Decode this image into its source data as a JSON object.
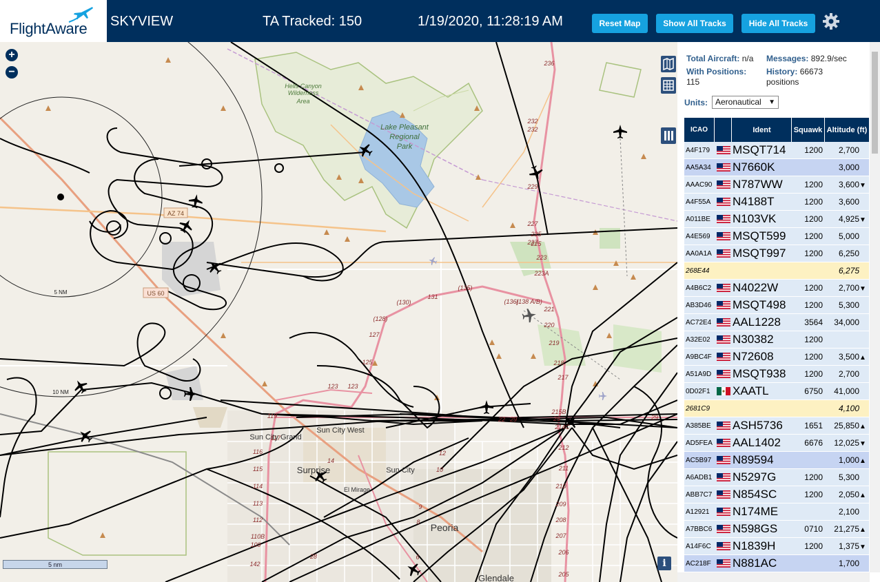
{
  "header": {
    "logo_text": "FlightAware",
    "app_title": "SKYVIEW",
    "tracked": "TA Tracked: 150",
    "datetime": "1/19/2020, 11:28:19 AM",
    "reset_label": "Reset Map",
    "show_label": "Show All Tracks",
    "hide_label": "Hide All Tracks"
  },
  "map": {
    "zoom_in": "+",
    "zoom_out": "−",
    "scale_label": "5 nm",
    "info_label": "i",
    "labels": {
      "hells_canyon": "Hells Canyon",
      "wilderness": "Wilderness",
      "area": "Area",
      "lake1": "Lake Pleasant",
      "lake2": "Regional",
      "lake3": "Park",
      "sun_city_grand": "Sun City Grand",
      "sun_city_west": "Sun City West",
      "surprise": "Surprise",
      "sun_city": "Sun City",
      "el_mirage": "El Mirage",
      "peoria": "Peoria",
      "glendale": "Glendale",
      "az74": "AZ 74",
      "us60": "US 60",
      "ring5": "5 NM",
      "ring10": "10 NM"
    },
    "road_numbers": [
      "236",
      "232",
      "232",
      "229",
      "227",
      "227",
      "225",
      "225",
      "223",
      "223A",
      "221",
      "220",
      "219",
      "218",
      "217",
      "215B",
      "214C",
      "212",
      "211",
      "210",
      "209",
      "208",
      "207",
      "206",
      "205",
      "(138 A/B)",
      "(136)",
      "(135)",
      "131",
      "(130)",
      "(128)",
      "127",
      "125",
      "123",
      "123",
      "119",
      "117",
      "116",
      "115",
      "114",
      "113",
      "112",
      "110B",
      "109",
      "142",
      "14",
      "12",
      "10",
      "9",
      "8",
      "6",
      "28",
      "29",
      "22",
      "25",
      "29"
    ]
  },
  "panel": {
    "total_label": "Total Aircraft:",
    "total_value": "n/a",
    "messages_label": "Messages:",
    "messages_value": "892.9/sec",
    "positions_label": "With Positions:",
    "positions_value": "115",
    "history_label": "History:",
    "history_value": "66673",
    "history_unit": "positions",
    "units_label": "Units:",
    "units_value": "Aeronautical"
  },
  "table": {
    "headers": {
      "icao": "ICAO",
      "flag": "",
      "ident": "Ident",
      "squawk": "Squawk",
      "altitude": "Altitude (ft)"
    },
    "rows": [
      {
        "icao": "A4F179",
        "flag": "us",
        "ident": "MSQT714",
        "squawk": "1200",
        "altitude": "2,700",
        "trend": "",
        "style": "blue"
      },
      {
        "icao": "AA5A34",
        "flag": "us",
        "ident": "N7660K",
        "squawk": "",
        "altitude": "3,000",
        "trend": "",
        "style": "selected"
      },
      {
        "icao": "AAAC90",
        "flag": "us",
        "ident": "N787WW",
        "squawk": "1200",
        "altitude": "3,600",
        "trend": "▼",
        "style": "blue"
      },
      {
        "icao": "A4F55A",
        "flag": "us",
        "ident": "N4188T",
        "squawk": "1200",
        "altitude": "3,600",
        "trend": "",
        "style": "blue"
      },
      {
        "icao": "A011BE",
        "flag": "us",
        "ident": "N103VK",
        "squawk": "1200",
        "altitude": "4,925",
        "trend": "▼",
        "style": "blue"
      },
      {
        "icao": "A4E569",
        "flag": "us",
        "ident": "MSQT599",
        "squawk": "1200",
        "altitude": "5,000",
        "trend": "",
        "style": "blue"
      },
      {
        "icao": "AA0A1A",
        "flag": "us",
        "ident": "MSQT997",
        "squawk": "1200",
        "altitude": "6,250",
        "trend": "",
        "style": "blue"
      },
      {
        "icao": "268E44",
        "flag": "",
        "ident": "",
        "squawk": "",
        "altitude": "6,275",
        "trend": "",
        "style": "yellow"
      },
      {
        "icao": "A4B6C2",
        "flag": "us",
        "ident": "N4022W",
        "squawk": "1200",
        "altitude": "2,700",
        "trend": "▼",
        "style": "blue"
      },
      {
        "icao": "AB3D46",
        "flag": "us",
        "ident": "MSQT498",
        "squawk": "1200",
        "altitude": "5,300",
        "trend": "",
        "style": "blue"
      },
      {
        "icao": "AC72E4",
        "flag": "us",
        "ident": "AAL1228",
        "squawk": "3564",
        "altitude": "34,000",
        "trend": "",
        "style": "blue"
      },
      {
        "icao": "A32E02",
        "flag": "us",
        "ident": "N30382",
        "squawk": "1200",
        "altitude": "",
        "trend": "",
        "style": "blue"
      },
      {
        "icao": "A9BC4F",
        "flag": "us",
        "ident": "N72608",
        "squawk": "1200",
        "altitude": "3,500",
        "trend": "▲",
        "style": "blue"
      },
      {
        "icao": "A51A9D",
        "flag": "us",
        "ident": "MSQT938",
        "squawk": "1200",
        "altitude": "2,700",
        "trend": "",
        "style": "blue"
      },
      {
        "icao": "0D02F1",
        "flag": "mx",
        "ident": "XAATL",
        "squawk": "6750",
        "altitude": "41,000",
        "trend": "",
        "style": "blue"
      },
      {
        "icao": "2681C9",
        "flag": "",
        "ident": "",
        "squawk": "",
        "altitude": "4,100",
        "trend": "",
        "style": "yellow"
      },
      {
        "icao": "A385BE",
        "flag": "us",
        "ident": "ASH5736",
        "squawk": "1651",
        "altitude": "25,850",
        "trend": "▲",
        "style": "blue"
      },
      {
        "icao": "AD5FEA",
        "flag": "us",
        "ident": "AAL1402",
        "squawk": "6676",
        "altitude": "12,025",
        "trend": "▼",
        "style": "blue"
      },
      {
        "icao": "AC5B97",
        "flag": "us",
        "ident": "N89594",
        "squawk": "",
        "altitude": "1,000",
        "trend": "▲",
        "style": "selected"
      },
      {
        "icao": "A6ADB1",
        "flag": "us",
        "ident": "N5297G",
        "squawk": "1200",
        "altitude": "5,300",
        "trend": "",
        "style": "blue"
      },
      {
        "icao": "ABB7C7",
        "flag": "us",
        "ident": "N854SC",
        "squawk": "1200",
        "altitude": "2,050",
        "trend": "▲",
        "style": "blue"
      },
      {
        "icao": "A12921",
        "flag": "us",
        "ident": "N174ME",
        "squawk": "",
        "altitude": "2,100",
        "trend": "",
        "style": "blue"
      },
      {
        "icao": "A7BBC6",
        "flag": "us",
        "ident": "N598GS",
        "squawk": "0710",
        "altitude": "21,275",
        "trend": "▲",
        "style": "blue"
      },
      {
        "icao": "A14F6C",
        "flag": "us",
        "ident": "N1839H",
        "squawk": "1200",
        "altitude": "1,375",
        "trend": "▼",
        "style": "blue"
      },
      {
        "icao": "AC218F",
        "flag": "us",
        "ident": "N881AC",
        "squawk": "",
        "altitude": "1,700",
        "trend": "",
        "style": "selected"
      }
    ]
  },
  "colors": {
    "header_bg": "#002f5d",
    "button_blue": "#16a2e0",
    "row_blue": "#dfeaf6",
    "row_selected": "#c6d4f2",
    "row_yellow": "#fdf1c2",
    "map_bg": "#f2efe8",
    "motorway": "#e892a2",
    "track": "#000000"
  },
  "icons": [
    "plane-logo-icon",
    "gear-icon",
    "zoom-in-icon",
    "zoom-out-icon",
    "map-layers-icon",
    "grid-icon",
    "columns-icon",
    "info-icon",
    "us-flag-icon",
    "mx-flag-icon",
    "aircraft-icon"
  ]
}
